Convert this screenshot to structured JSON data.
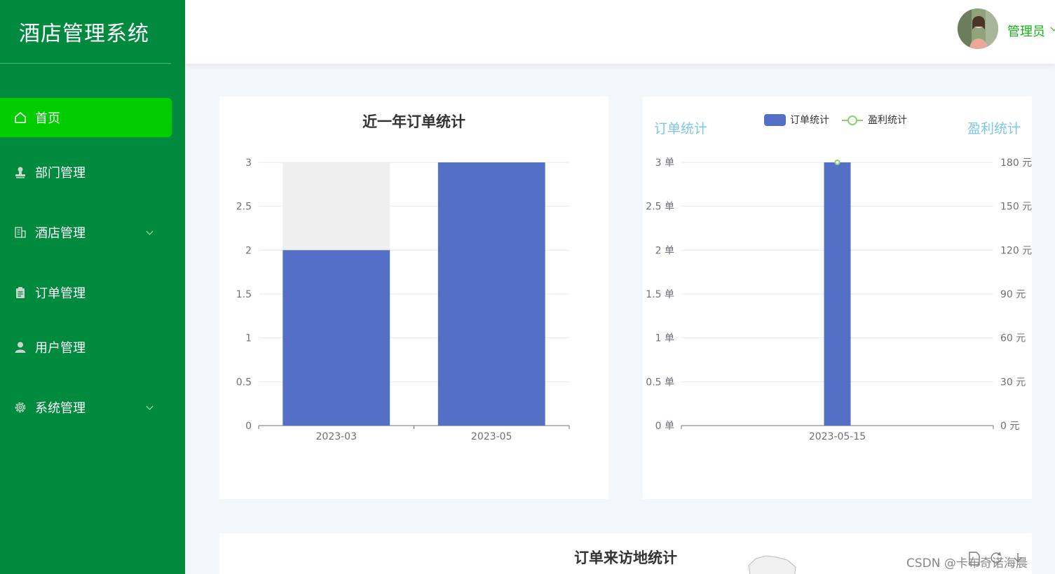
{
  "app": {
    "title": "酒店管理系统"
  },
  "sidebar": {
    "items": [
      {
        "label": "首页",
        "icon": "home-icon",
        "active": true
      },
      {
        "label": "部门管理",
        "icon": "stamp-icon"
      },
      {
        "label": "酒店管理",
        "icon": "building-icon",
        "has_children": true
      },
      {
        "label": "订单管理",
        "icon": "clipboard-icon"
      },
      {
        "label": "用户管理",
        "icon": "user-icon"
      },
      {
        "label": "系统管理",
        "icon": "gear-icon",
        "has_children": true
      }
    ]
  },
  "header": {
    "user_name": "管理员"
  },
  "colors": {
    "sidebar": "#008a3e",
    "active": "#00cc00",
    "bar": "#536fc6",
    "line": "#91cc75",
    "axis_name": "#7ec6e8"
  },
  "chart_data": [
    {
      "type": "bar",
      "title": "近一年订单统计",
      "categories": [
        "2023-03",
        "2023-05"
      ],
      "values": [
        2,
        3
      ],
      "background_max": 3,
      "ylim": [
        0,
        3
      ],
      "yticks": [
        "0",
        "0.5",
        "1",
        "1.5",
        "2",
        "2.5",
        "3"
      ]
    },
    {
      "type": "bar",
      "categories": [
        "2023-05-15"
      ],
      "series": [
        {
          "name": "订单统计",
          "type": "bar",
          "values": [
            3
          ],
          "axis": "left"
        },
        {
          "name": "盈利统计",
          "type": "line",
          "values": [
            180
          ],
          "axis": "right"
        }
      ],
      "legend": [
        "订单统计",
        "盈利统计"
      ],
      "legend_position": "top",
      "left_axis_name": "订单统计",
      "right_axis_name": "盈利统计",
      "left_ylim": [
        0,
        3
      ],
      "right_ylim": [
        0,
        180
      ],
      "left_ticks": [
        "0 单",
        "0.5 单",
        "1 单",
        "1.5 单",
        "2 单",
        "2.5 单",
        "3 单"
      ],
      "right_ticks": [
        "0 元",
        "30 元",
        "60 元",
        "90 元",
        "120 元",
        "150 元",
        "180 元"
      ]
    }
  ],
  "bottom_card": {
    "title": "订单来访地统计"
  },
  "watermark": "CSDN @卡布奇诺海晨"
}
